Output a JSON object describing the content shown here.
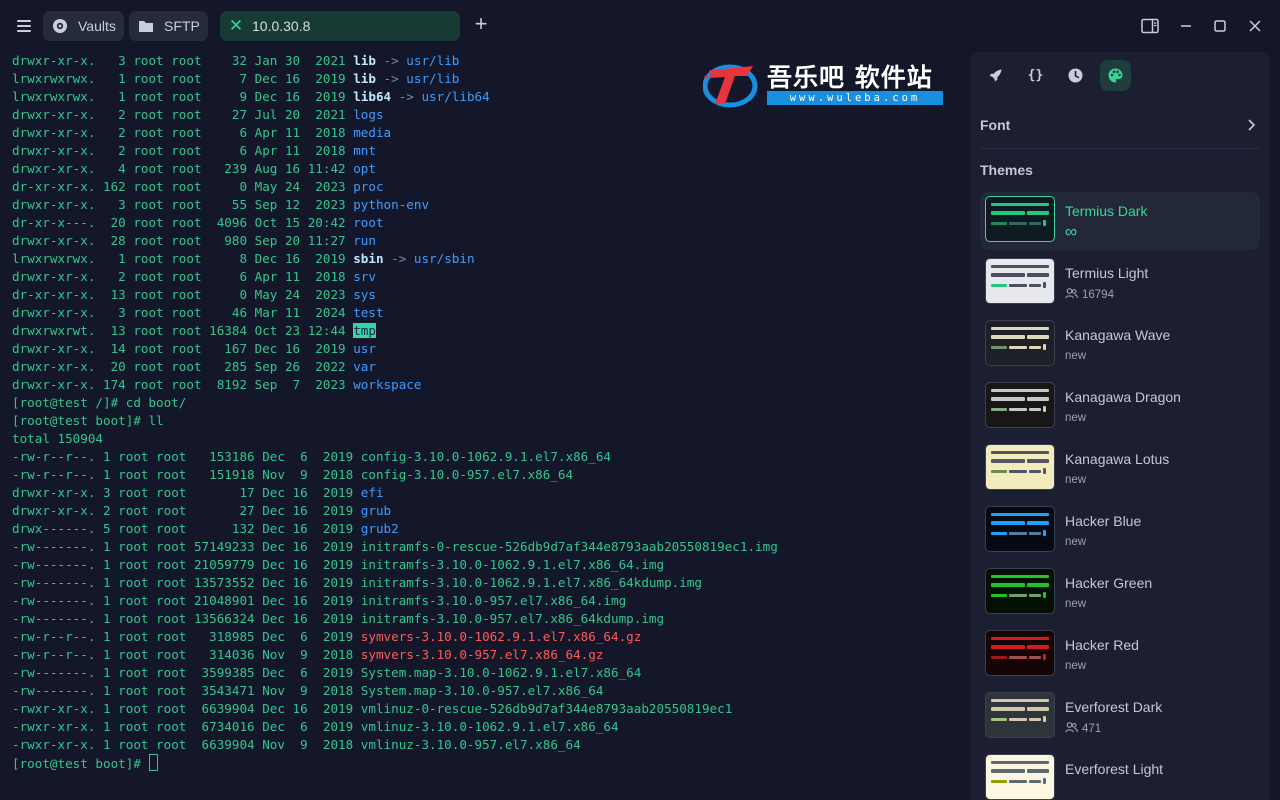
{
  "titlebar": {
    "tabs": [
      {
        "label": "Vaults",
        "icon": "vault-icon"
      },
      {
        "label": "SFTP",
        "icon": "folder-icon"
      },
      {
        "label": "10.0.30.8",
        "icon": "close-icon",
        "active": true
      }
    ]
  },
  "terminal": {
    "lines": [
      {
        "meta": "drwxr-xr-x.   3 root root    32 Jan 30  2021 ",
        "name": "lib",
        "kind": "link",
        "arrow": " -> ",
        "target": "usr/lib"
      },
      {
        "meta": "lrwxrwxrwx.   1 root root     7 Dec 16  2019 ",
        "name": "lib",
        "kind": "link",
        "arrow": " -> ",
        "target": "usr/lib"
      },
      {
        "meta": "lrwxrwxrwx.   1 root root     9 Dec 16  2019 ",
        "name": "lib64",
        "kind": "link",
        "arrow": " -> ",
        "target": "usr/lib64"
      },
      {
        "meta": "drwxr-xr-x.   2 root root    27 Jul 20  2021 ",
        "name": "logs",
        "kind": "dir"
      },
      {
        "meta": "drwxr-xr-x.   2 root root     6 Apr 11  2018 ",
        "name": "media",
        "kind": "dir"
      },
      {
        "meta": "drwxr-xr-x.   2 root root     6 Apr 11  2018 ",
        "name": "mnt",
        "kind": "dir"
      },
      {
        "meta": "drwxr-xr-x.   4 root root   239 Aug 16 11:42 ",
        "name": "opt",
        "kind": "dir"
      },
      {
        "meta": "dr-xr-xr-x. 162 root root     0 May 24  2023 ",
        "name": "proc",
        "kind": "dir"
      },
      {
        "meta": "drwxr-xr-x.   3 root root    55 Sep 12  2023 ",
        "name": "python-env",
        "kind": "dir"
      },
      {
        "meta": "dr-xr-x---.  20 root root  4096 Oct 15 20:42 ",
        "name": "root",
        "kind": "dir"
      },
      {
        "meta": "drwxr-xr-x.  28 root root   980 Sep 20 11:27 ",
        "name": "run",
        "kind": "dir"
      },
      {
        "meta": "lrwxrwxrwx.   1 root root     8 Dec 16  2019 ",
        "name": "sbin",
        "kind": "link",
        "arrow": " -> ",
        "target": "usr/sbin"
      },
      {
        "meta": "drwxr-xr-x.   2 root root     6 Apr 11  2018 ",
        "name": "srv",
        "kind": "dir"
      },
      {
        "meta": "dr-xr-xr-x.  13 root root     0 May 24  2023 ",
        "name": "sys",
        "kind": "dir"
      },
      {
        "meta": "drwxr-xr-x.   3 root root    46 Mar 11  2024 ",
        "name": "test",
        "kind": "dir"
      },
      {
        "meta": "drwxrwxrwt.  13 root root 16384 Oct 23 12:44 ",
        "name": "tmp",
        "kind": "hl"
      },
      {
        "meta": "drwxr-xr-x.  14 root root   167 Dec 16  2019 ",
        "name": "usr",
        "kind": "dir"
      },
      {
        "meta": "drwxr-xr-x.  20 root root   285 Sep 26  2022 ",
        "name": "var",
        "kind": "dir"
      },
      {
        "meta": "drwxr-xr-x. 174 root root  8192 Sep  7  2023 ",
        "name": "workspace",
        "kind": "dir"
      },
      {
        "meta": "[root@test /]# cd boot/",
        "kind": "prompt"
      },
      {
        "meta": "[root@test boot]# ll",
        "kind": "prompt"
      },
      {
        "meta": "total 150904",
        "kind": "plain"
      },
      {
        "meta": "-rw-r--r--. 1 root root   153186 Dec  6  2019 ",
        "name": "config-3.10.0-1062.9.1.el7.x86_64",
        "kind": "file"
      },
      {
        "meta": "-rw-r--r--. 1 root root   151918 Nov  9  2018 ",
        "name": "config-3.10.0-957.el7.x86_64",
        "kind": "file"
      },
      {
        "meta": "drwxr-xr-x. 3 root root       17 Dec 16  2019 ",
        "name": "efi",
        "kind": "dir"
      },
      {
        "meta": "drwxr-xr-x. 2 root root       27 Dec 16  2019 ",
        "name": "grub",
        "kind": "dir"
      },
      {
        "meta": "drwx------. 5 root root      132 Dec 16  2019 ",
        "name": "grub2",
        "kind": "dir"
      },
      {
        "meta": "-rw-------. 1 root root 57149233 Dec 16  2019 ",
        "name": "initramfs-0-rescue-526db9d7af344e8793aab20550819ec1.img",
        "kind": "file"
      },
      {
        "meta": "-rw-------. 1 root root 21059779 Dec 16  2019 ",
        "name": "initramfs-3.10.0-1062.9.1.el7.x86_64.img",
        "kind": "file"
      },
      {
        "meta": "-rw-------. 1 root root 13573552 Dec 16  2019 ",
        "name": "initramfs-3.10.0-1062.9.1.el7.x86_64kdump.img",
        "kind": "file"
      },
      {
        "meta": "-rw-------. 1 root root 21048901 Dec 16  2019 ",
        "name": "initramfs-3.10.0-957.el7.x86_64.img",
        "kind": "file"
      },
      {
        "meta": "-rw-------. 1 root root 13566324 Dec 16  2019 ",
        "name": "initramfs-3.10.0-957.el7.x86_64kdump.img",
        "kind": "file"
      },
      {
        "meta": "-rw-r--r--. 1 root root   318985 Dec  6  2019 ",
        "name": "symvers-3.10.0-1062.9.1.el7.x86_64.gz",
        "kind": "red"
      },
      {
        "meta": "-rw-r--r--. 1 root root   314036 Nov  9  2018 ",
        "name": "symvers-3.10.0-957.el7.x86_64.gz",
        "kind": "red"
      },
      {
        "meta": "-rw-------. 1 root root  3599385 Dec  6  2019 ",
        "name": "System.map-3.10.0-1062.9.1.el7.x86_64",
        "kind": "file"
      },
      {
        "meta": "-rw-------. 1 root root  3543471 Nov  9  2018 ",
        "name": "System.map-3.10.0-957.el7.x86_64",
        "kind": "file"
      },
      {
        "meta": "-rwxr-xr-x. 1 root root  6639904 Dec 16  2019 ",
        "name": "vmlinuz-0-rescue-526db9d7af344e8793aab20550819ec1",
        "kind": "file"
      },
      {
        "meta": "-rwxr-xr-x. 1 root root  6734016 Dec  6  2019 ",
        "name": "vmlinuz-3.10.0-1062.9.1.el7.x86_64",
        "kind": "file"
      },
      {
        "meta": "-rwxr-xr-x. 1 root root  6639904 Nov  9  2018 ",
        "name": "vmlinuz-3.10.0-957.el7.x86_64",
        "kind": "file"
      }
    ],
    "prompt": "[root@test boot]# "
  },
  "watermark": {
    "title": "吾乐吧 软件站",
    "url": "www.wuleba.com"
  },
  "panel": {
    "toolbar": [
      "rocket-icon",
      "code-braces-icon",
      "history-icon",
      "palette-icon"
    ],
    "braces": "{}",
    "font_label": "Font",
    "themes_label": "Themes",
    "themes": [
      {
        "name": "Termius Dark",
        "sub": "∞",
        "sub_kind": "infinity",
        "selected": true,
        "bg": "#0f1a22",
        "c1": "#23c77a",
        "c2": "#1e8a5a",
        "c3": "#2f6a5a"
      },
      {
        "name": "Termius Light",
        "sub": "16794",
        "sub_kind": "users",
        "bg": "#e6e8ee",
        "c1": "#4a4f60",
        "c2": "#23c77a",
        "c3": "#4a4f60"
      },
      {
        "name": "Kanagawa Wave",
        "sub": "new",
        "sub_kind": "plain",
        "bg": "#1f1f28",
        "c1": "#dcd7ba",
        "c2": "#76946a",
        "c3": "#dcd7ba"
      },
      {
        "name": "Kanagawa Dragon",
        "sub": "new",
        "sub_kind": "plain",
        "bg": "#181616",
        "c1": "#c5c9c5",
        "c2": "#87a987",
        "c3": "#c5c9c5"
      },
      {
        "name": "Kanagawa Lotus",
        "sub": "new",
        "sub_kind": "plain",
        "bg": "#f2ecbc",
        "c1": "#545464",
        "c2": "#6f894e",
        "c3": "#545464"
      },
      {
        "name": "Hacker Blue",
        "sub": "new",
        "sub_kind": "plain",
        "bg": "#050a14",
        "c1": "#1ea0ff",
        "c2": "#1ea0ff",
        "c3": "#5a7aa0"
      },
      {
        "name": "Hacker Green",
        "sub": "new",
        "sub_kind": "plain",
        "bg": "#041004",
        "c1": "#22c322",
        "c2": "#22c322",
        "c3": "#70a070"
      },
      {
        "name": "Hacker Red",
        "sub": "new",
        "sub_kind": "plain",
        "bg": "#140404",
        "c1": "#d41c1c",
        "c2": "#a01818",
        "c3": "#a05050"
      },
      {
        "name": "Everforest Dark",
        "sub": "471",
        "sub_kind": "users",
        "bg": "#2d353b",
        "c1": "#d3c6aa",
        "c2": "#a7c080",
        "c3": "#d3c6aa"
      },
      {
        "name": "Everforest Light",
        "sub": "",
        "sub_kind": "plain",
        "bg": "#fdf6e3",
        "c1": "#5c6a72",
        "c2": "#8da101",
        "c3": "#5c6a72"
      }
    ]
  }
}
